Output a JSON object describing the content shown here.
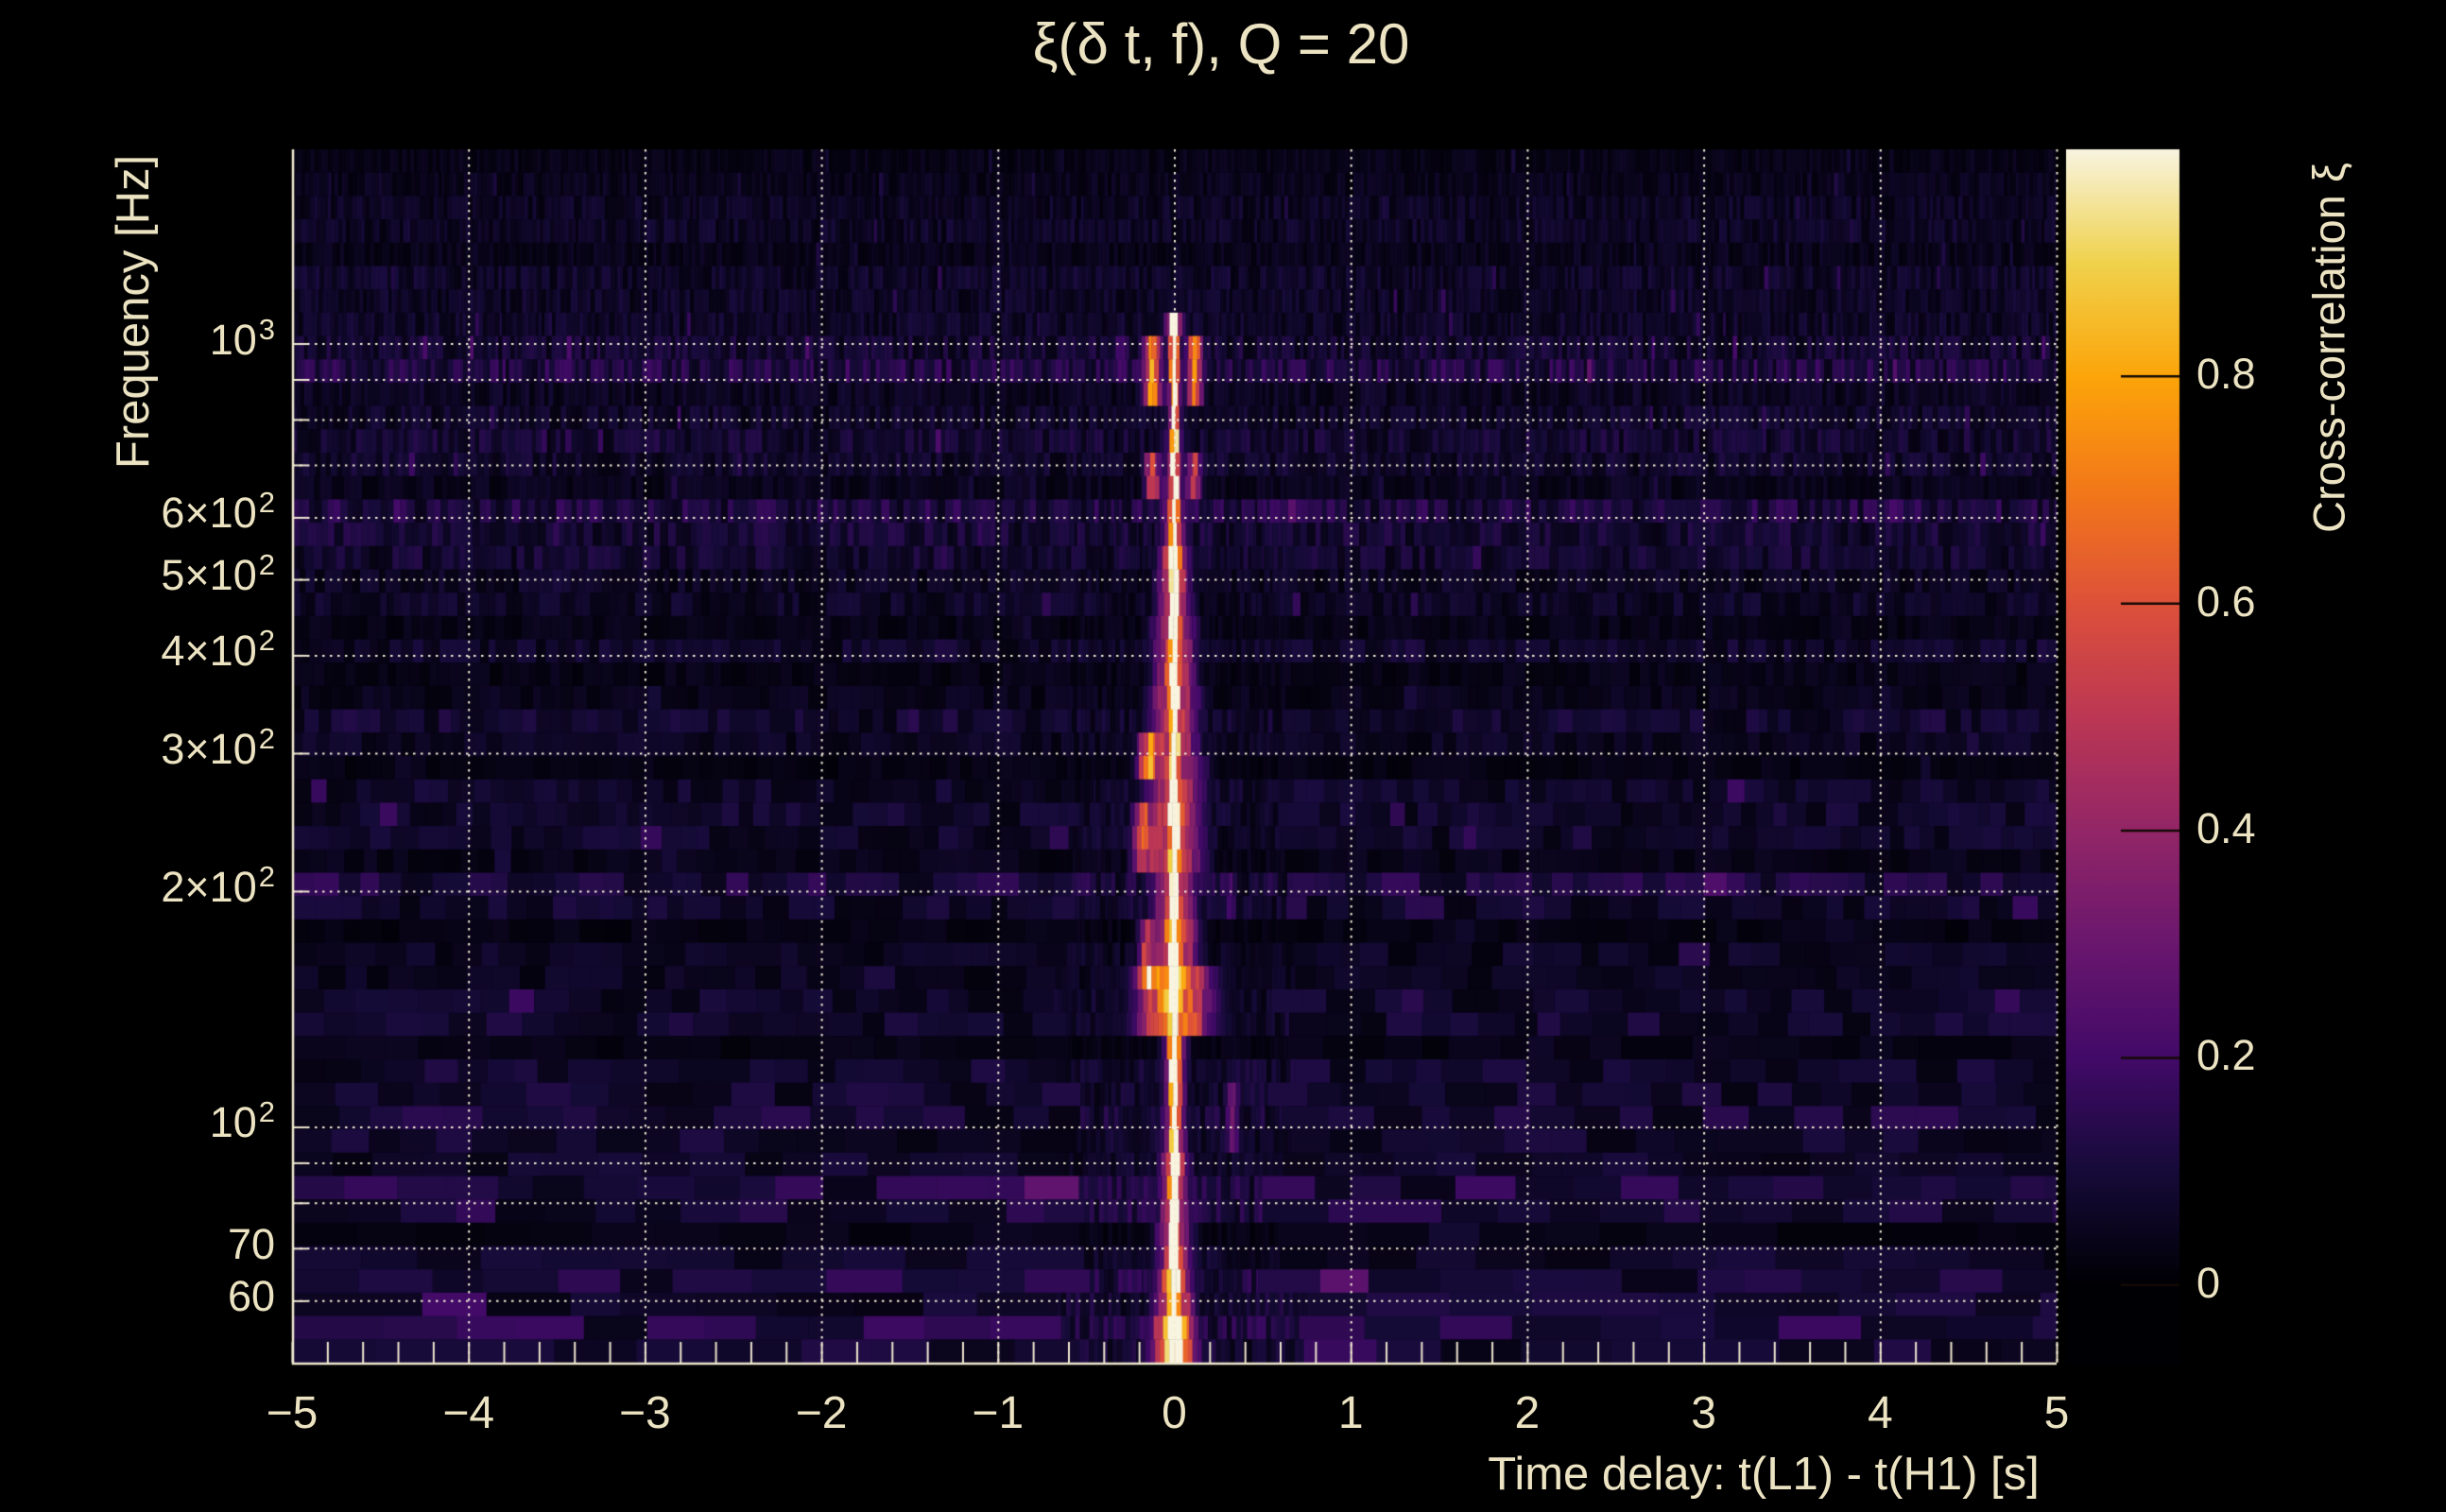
{
  "title": "ξ(δ t, f), Q = 20",
  "colors": {
    "background": "#000000",
    "text": "#ece3c2",
    "grid": "#f5eed8",
    "spine": "#efe7cf",
    "colorbar_tick": "#140a04"
  },
  "chart_data": {
    "type": "heatmap",
    "title": "ξ(δ t, f), Q = 20",
    "xlabel": "Time delay: t(L1) - t(H1) [s]",
    "ylabel": "Frequency [Hz]",
    "x_scale": "linear",
    "xlim": [
      -5,
      5
    ],
    "x_tick_labels": [
      {
        "v": -5,
        "label": "−5"
      },
      {
        "v": -4,
        "label": "−4"
      },
      {
        "v": -3,
        "label": "−3"
      },
      {
        "v": -2,
        "label": "−2"
      },
      {
        "v": -1,
        "label": "−1"
      },
      {
        "v": 0,
        "label": "0"
      },
      {
        "v": 1,
        "label": "1"
      },
      {
        "v": 2,
        "label": "2"
      },
      {
        "v": 3,
        "label": "3"
      },
      {
        "v": 4,
        "label": "4"
      },
      {
        "v": 5,
        "label": "5"
      }
    ],
    "x_minor_tick_step": 0.2,
    "x_gridlines": [
      -4,
      -3,
      -2,
      -1,
      0,
      1,
      2,
      3,
      4,
      5
    ],
    "y_scale": "log",
    "ylim": [
      50,
      1770
    ],
    "y_tick_labels": [
      {
        "f": 1000,
        "base": "10",
        "exp": "3"
      },
      {
        "f": 600,
        "base": "6×10",
        "exp": "2"
      },
      {
        "f": 500,
        "base": "5×10",
        "exp": "2"
      },
      {
        "f": 400,
        "base": "4×10",
        "exp": "2"
      },
      {
        "f": 300,
        "base": "3×10",
        "exp": "2"
      },
      {
        "f": 200,
        "base": "2×10",
        "exp": "2"
      },
      {
        "f": 100,
        "base": "10",
        "exp": "2"
      },
      {
        "f": 70,
        "base": "70",
        "exp": ""
      },
      {
        "f": 60,
        "base": "60",
        "exp": ""
      }
    ],
    "y_gridlines": [
      60,
      70,
      80,
      90,
      100,
      200,
      300,
      400,
      500,
      600,
      700,
      800,
      900,
      1000
    ],
    "grid_style": "dotted",
    "colorbar": {
      "label": "Cross-correlation ξ",
      "tick_labels": [
        {
          "v": 0.8,
          "label": "0.8"
        },
        {
          "v": 0.6,
          "label": "0.6"
        },
        {
          "v": 0.4,
          "label": "0.4"
        },
        {
          "v": 0.2,
          "label": "0.2"
        },
        {
          "v": 0.0,
          "label": "0"
        }
      ],
      "range": [
        -0.07,
        1.0
      ]
    },
    "colormap": {
      "name": "inferno",
      "stops": [
        [
          0.0,
          "#000004"
        ],
        [
          0.1,
          "#160b39"
        ],
        [
          0.2,
          "#420a68"
        ],
        [
          0.3,
          "#6a176e"
        ],
        [
          0.4,
          "#932667"
        ],
        [
          0.5,
          "#bc3754"
        ],
        [
          0.6,
          "#dd513a"
        ],
        [
          0.7,
          "#f37819"
        ],
        [
          0.8,
          "#fca50a"
        ],
        [
          0.9,
          "#f0d24c"
        ],
        [
          1.0,
          "#f8f4e0"
        ]
      ]
    },
    "signal": {
      "description": "Bright cross-correlation ridge at zero time delay spanning ~50–1060 Hz with hollow ring lobes near 650–1000 Hz",
      "core": {
        "dt": 0.0,
        "width_s": 0.02,
        "f_range": [
          50,
          1062
        ],
        "peak": 1.0
      },
      "wings": [
        {
          "f": [
            50,
            57
          ],
          "half_width_s": 0.16,
          "peak": 0.95
        },
        {
          "f": [
            57,
            66
          ],
          "half_width_s": 0.14,
          "peak": 0.72
        },
        {
          "f": [
            66,
            78
          ],
          "half_width_s": 0.13,
          "peak": 0.55
        },
        {
          "f": [
            78,
            95
          ],
          "half_width_s": 0.11,
          "peak": 0.58
        },
        {
          "f": [
            95,
            130
          ],
          "half_width_s": 0.09,
          "peak": 0.55
        },
        {
          "f": [
            130,
            158
          ],
          "half_width_s": 0.27,
          "peak": 0.78
        },
        {
          "f": [
            158,
            188
          ],
          "half_width_s": 0.17,
          "peak": 0.68
        },
        {
          "f": [
            188,
            218
          ],
          "half_width_s": 0.16,
          "peak": 0.58
        },
        {
          "f": [
            218,
            262
          ],
          "half_width_s": 0.21,
          "peak": 0.62
        },
        {
          "f": [
            262,
            305
          ],
          "half_width_s": 0.22,
          "peak": 0.52
        },
        {
          "f": [
            305,
            365
          ],
          "half_width_s": 0.18,
          "peak": 0.55
        },
        {
          "f": [
            365,
            445
          ],
          "half_width_s": 0.15,
          "peak": 0.6
        },
        {
          "f": [
            445,
            545
          ],
          "half_width_s": 0.12,
          "peak": 0.62
        },
        {
          "f": [
            545,
            645
          ],
          "half_width_s": 0.1,
          "peak": 0.42
        },
        {
          "f": [
            645,
            765
          ],
          "half_width_s": 0.09,
          "peak": 0.33
        },
        {
          "f": [
            765,
            835
          ],
          "half_width_s": 0.07,
          "peak": 0.28
        },
        {
          "f": [
            835,
            1010
          ],
          "half_width_s": 0.06,
          "peak": 0.32
        },
        {
          "f": [
            1010,
            1065
          ],
          "half_width_s": 0.07,
          "peak": 0.6
        },
        {
          "f": [
            1065,
            1200
          ],
          "half_width_s": 0.12,
          "peak": 0.08
        }
      ],
      "side_lobes": [
        {
          "f": [
            835,
            1010
          ],
          "dt": -0.125,
          "width_s": 0.05,
          "peak": 0.7
        },
        {
          "f": [
            835,
            1010
          ],
          "dt": 0.115,
          "width_s": 0.045,
          "peak": 0.65
        },
        {
          "f": [
            625,
            748
          ],
          "dt": -0.125,
          "width_s": 0.045,
          "peak": 0.52
        },
        {
          "f": [
            625,
            748
          ],
          "dt": 0.115,
          "width_s": 0.04,
          "peak": 0.47
        },
        {
          "f": [
            862,
            995
          ],
          "dt": -0.3,
          "width_s": 0.05,
          "peak": 0.22
        },
        {
          "f": [
            272,
            320
          ],
          "dt": -0.15,
          "width_s": 0.05,
          "peak": 0.55
        },
        {
          "f": [
            218,
            266
          ],
          "dt": -0.185,
          "width_s": 0.05,
          "peak": 0.45
        },
        {
          "f": [
            150,
            182
          ],
          "dt": -0.155,
          "width_s": 0.04,
          "peak": 0.45
        },
        {
          "f": [
            95,
            115
          ],
          "dt": 0.33,
          "width_s": 0.04,
          "peak": 0.28
        },
        {
          "f": [
            185,
            215
          ],
          "dt": 0.32,
          "width_s": 0.04,
          "peak": 0.2
        }
      ]
    },
    "noise": {
      "seed": 1337,
      "base_value": 0.05,
      "bands": [
        {
          "f": [
            900,
            1010
          ],
          "boost": 0.05
        },
        {
          "f": [
            560,
            620
          ],
          "boost": 0.035
        },
        {
          "f": [
            380,
            430
          ],
          "boost": 0.03
        },
        {
          "f": [
            195,
            218
          ],
          "boost": 0.045
        },
        {
          "f": [
            100,
            113
          ],
          "boost": 0.045
        },
        {
          "f": [
            78,
            92
          ],
          "boost": 0.035
        },
        {
          "f": [
            58,
            72
          ],
          "boost": 0.03
        },
        {
          "f": [
            50,
            57
          ],
          "boost": 0.05
        }
      ]
    }
  }
}
